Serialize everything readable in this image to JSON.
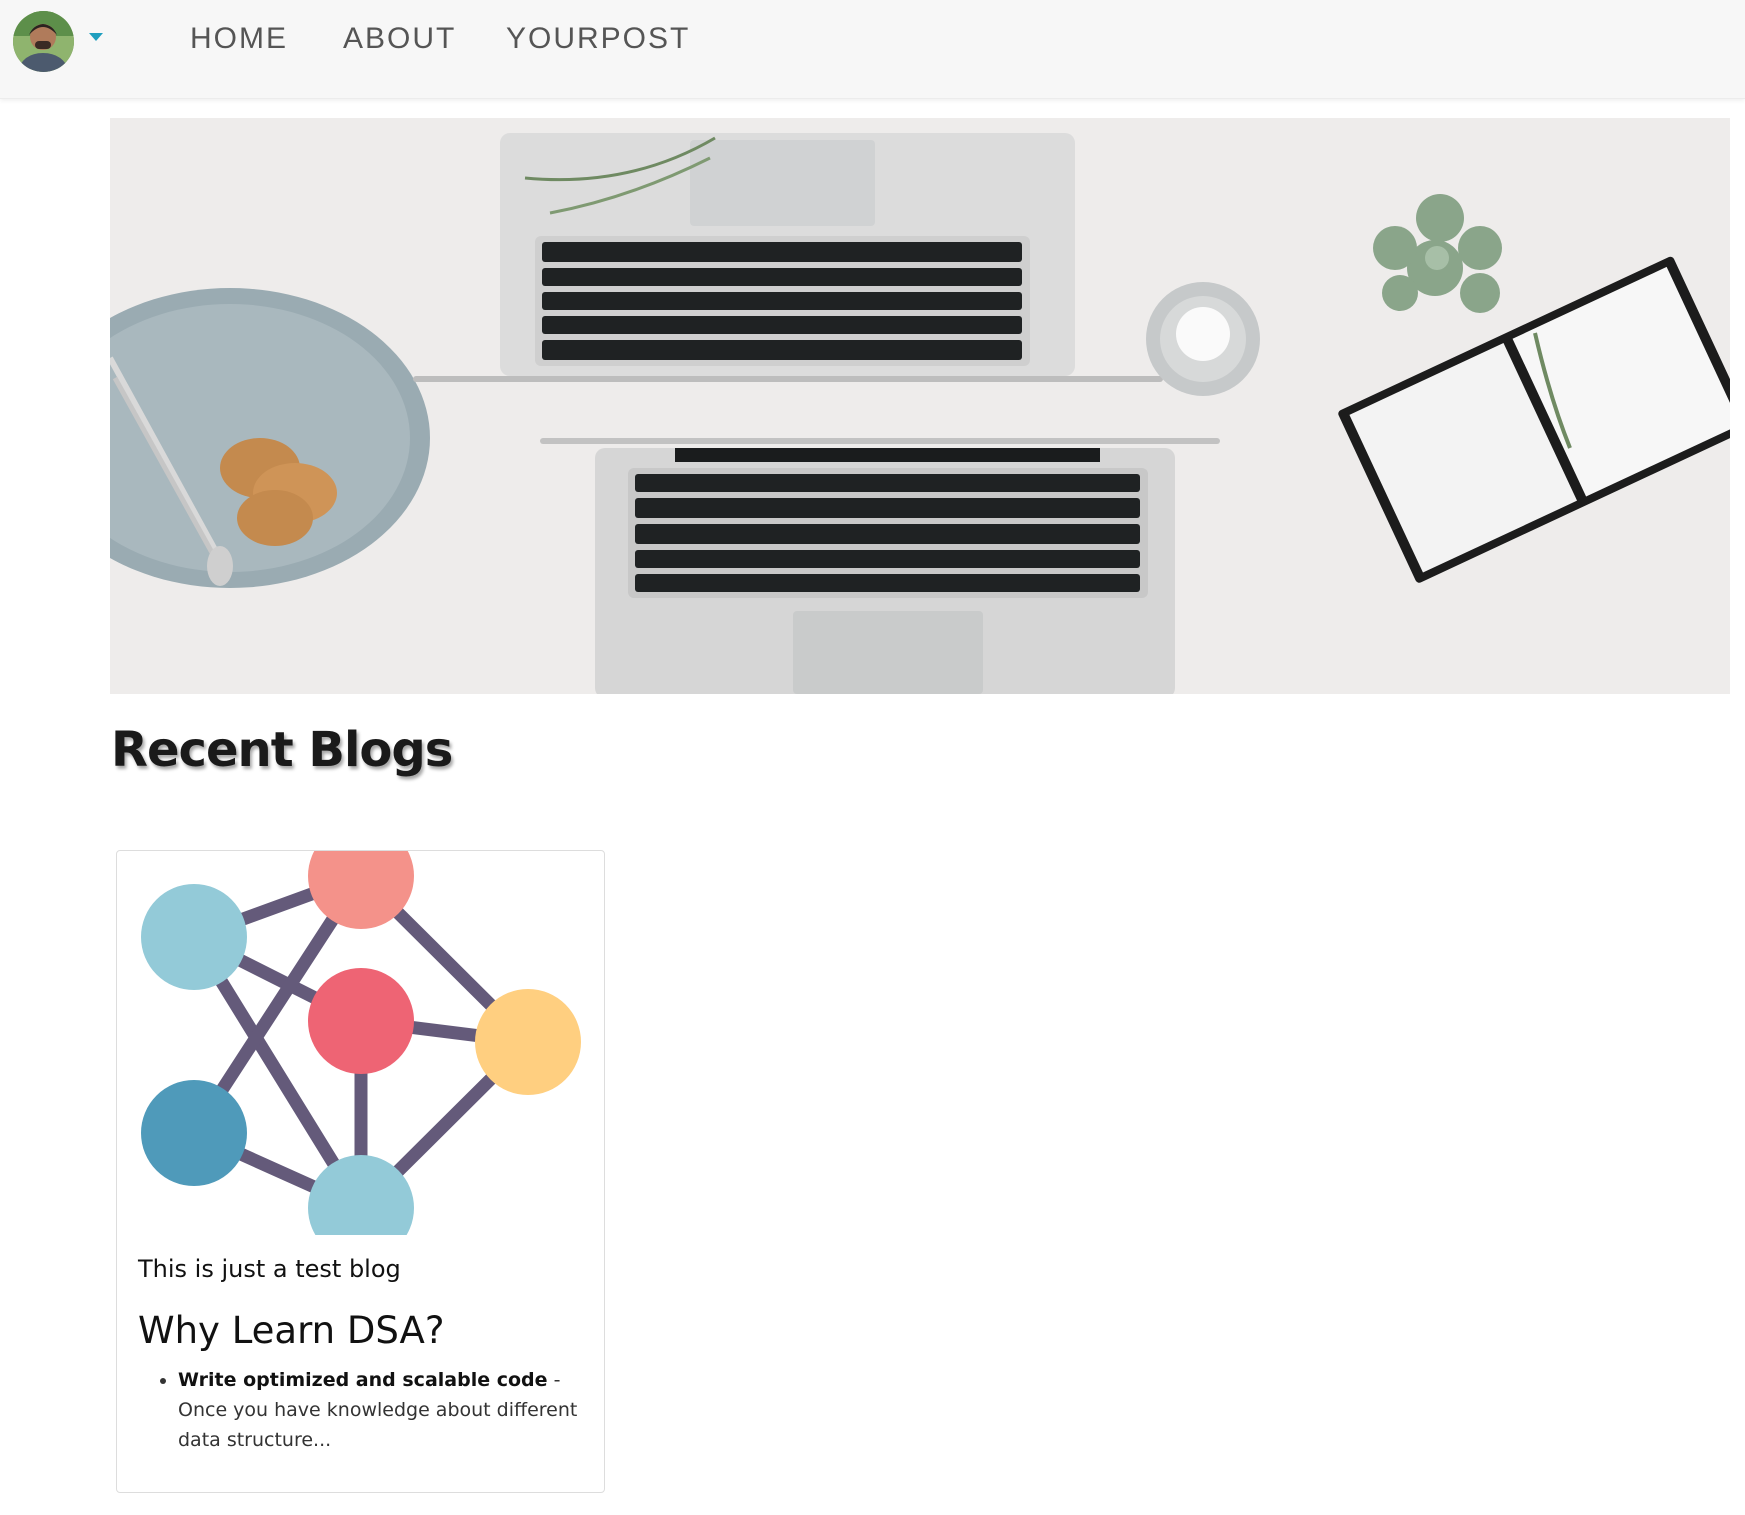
{
  "nav": {
    "avatar_alt": "profile avatar",
    "links": [
      {
        "label": "HOME"
      },
      {
        "label": "ABOUT"
      },
      {
        "label": "YOURPOST"
      }
    ]
  },
  "hero": {
    "alt": "laptops on desk"
  },
  "section": {
    "title": "Recent Blogs"
  },
  "blogs": [
    {
      "image_alt": "network graph illustration",
      "subtitle": "This is just a test blog",
      "title": "Why Learn DSA?",
      "excerpt_bold": "Write optimized and scalable code",
      "excerpt_rest": " - Once you have knowledge about different data structure..."
    }
  ],
  "colors": {
    "accent": "#1f9fbf",
    "nav_bg": "#f7f7f7",
    "node_pink": "#f4928a",
    "node_red": "#ee6474",
    "node_light_blue": "#93cad8",
    "node_blue": "#4f9aba",
    "node_yellow": "#ffcf80",
    "edge": "#645a7a"
  }
}
